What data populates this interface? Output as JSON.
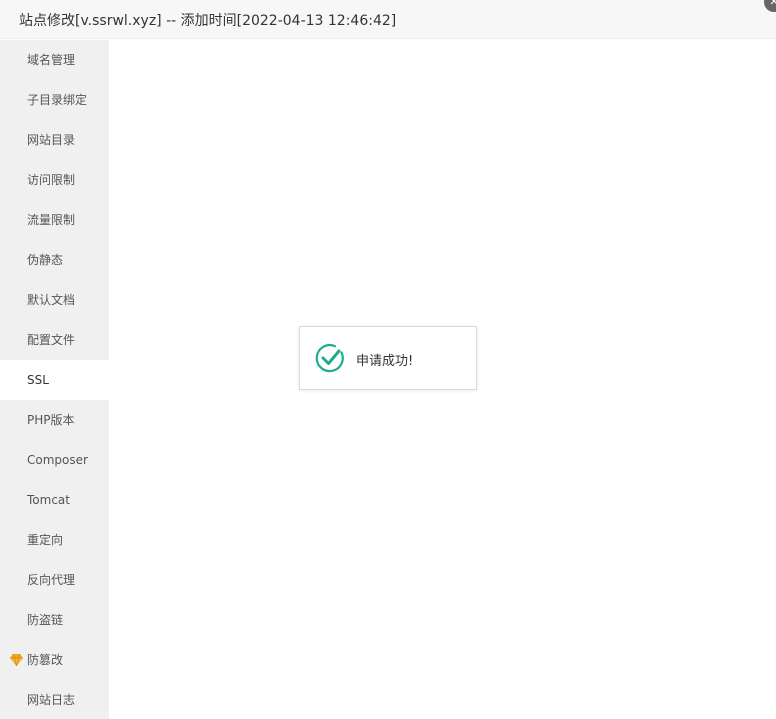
{
  "window": {
    "title": "站点修改[v.ssrwl.xyz] -- 添加时间[2022-04-13 12:46:42]",
    "close_symbol": "✕"
  },
  "sidebar": {
    "items": [
      {
        "label": "域名管理",
        "active": false
      },
      {
        "label": "子目录绑定",
        "active": false
      },
      {
        "label": "网站目录",
        "active": false
      },
      {
        "label": "访问限制",
        "active": false
      },
      {
        "label": "流量限制",
        "active": false
      },
      {
        "label": "伪静态",
        "active": false
      },
      {
        "label": "默认文档",
        "active": false
      },
      {
        "label": "配置文件",
        "active": false
      },
      {
        "label": "SSL",
        "active": true
      },
      {
        "label": "PHP版本",
        "active": false
      },
      {
        "label": "Composer",
        "active": false
      },
      {
        "label": "Tomcat",
        "active": false
      },
      {
        "label": "重定向",
        "active": false
      },
      {
        "label": "反向代理",
        "active": false
      },
      {
        "label": "防盗链",
        "active": false
      },
      {
        "label": "防篡改",
        "active": false,
        "icon": "gem-icon"
      },
      {
        "label": "网站日志",
        "active": false
      }
    ]
  },
  "toast": {
    "message": "申请成功!",
    "icon": "success-check-icon",
    "color": "#1aae8e"
  },
  "colors": {
    "sidebar_bg": "#f0f0f0",
    "titlebar_bg": "#f7f7f7",
    "gem": "#f5a623"
  }
}
